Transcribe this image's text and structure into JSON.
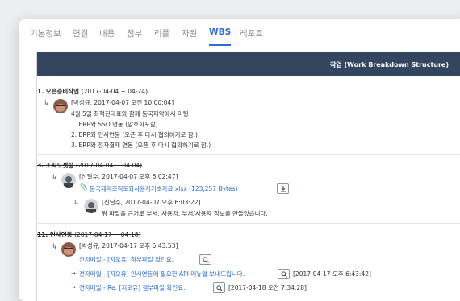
{
  "tabs": [
    {
      "label": "기본정보"
    },
    {
      "label": "연결"
    },
    {
      "label": "내용"
    },
    {
      "label": "첨부"
    },
    {
      "label": "리플"
    },
    {
      "label": "자원"
    },
    {
      "label": "WBS"
    },
    {
      "label": "레포트"
    }
  ],
  "header": {
    "title": "작업 (Work Breakdown Structure)"
  },
  "items": [
    {
      "title": "1. 오픈준비작업",
      "date_range": "(2017-04-04 ~ 04-24)",
      "comment": {
        "author_time": "[박성규, 2017-04-07 오전 10:00:04]",
        "lines": [
          "4월 5일 최혁진대표와 함께 동국제약에서 미팅",
          "1. ERP와 SSO 연동 (암호화포함)",
          "2. ERP와 인사연동 (오픈 후 다시 협의하기로 함.)",
          "3. ERP와 전자결재 연동 (오픈 후 다시 협의하기로 함.)"
        ]
      }
    },
    {
      "title": "3. 조직도셋팅",
      "date_range": "(2017-04-04 ~ 04-04)",
      "comment1": {
        "author_time": "[신달수, 2017-04-07 오후 6:02:47]",
        "attachment": "동국제약조직도와사용자기초자료.xlsx (123,257 Bytes)"
      },
      "comment2": {
        "author_time": "[신달수, 2017-04-07 오후 6:03:22]",
        "text": "위 파일을 근거로 부서, 사용자, 부서/사용자 정보를 만들었습니다."
      }
    },
    {
      "title": "11. 인사연동",
      "date_range": "(2017-04-17 ~ 04-18)",
      "comment": {
        "author_time": "[박성규, 2017-04-17 오후 6:43:53]",
        "mails": [
          {
            "text": "전자메일 - [지오유] 첨부파일 확인요.",
            "time": ""
          },
          {
            "text": "전자메일 - [지오유] 인사연동에 필요한 API 매뉴얼 보내드립니다.",
            "time": "[2017-04-17 오후 6:43:42]"
          },
          {
            "text": "전자메일 - Re: [지오유] 첨부파일 확인요.",
            "time": "[2017-04-18 오전 7:34:28]"
          }
        ]
      }
    }
  ],
  "colors": {
    "accent": "#2d6bd6",
    "header_bg": "#34465f"
  }
}
